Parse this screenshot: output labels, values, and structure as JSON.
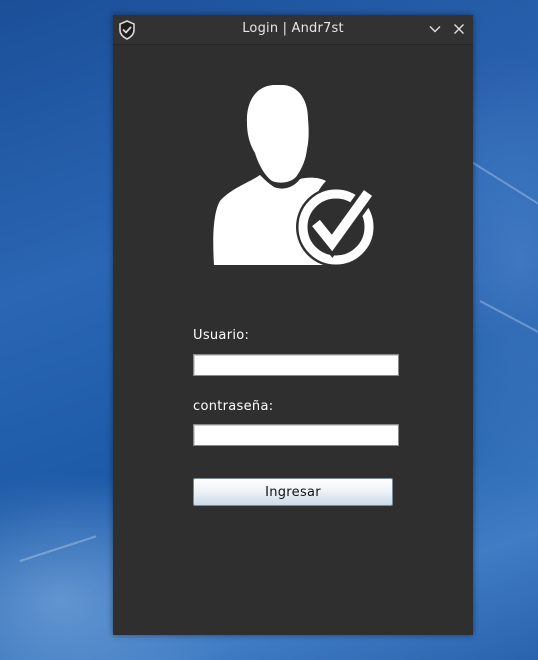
{
  "window": {
    "title": "Login | Andr7st",
    "app_icon": "shield-check-icon",
    "controls": {
      "minimize_icon": "chevron-down-icon",
      "close_icon": "close-icon"
    }
  },
  "form": {
    "avatar_icon": "user-verified-icon",
    "username_label": "Usuario:",
    "username_value": "",
    "password_label": "contraseña:",
    "password_value": "",
    "submit_label": "Ingresar"
  },
  "colors": {
    "window_bg": "#2f2f2f",
    "titlebar_bg": "#323232",
    "desktop_blue": "#1d5aa8"
  }
}
